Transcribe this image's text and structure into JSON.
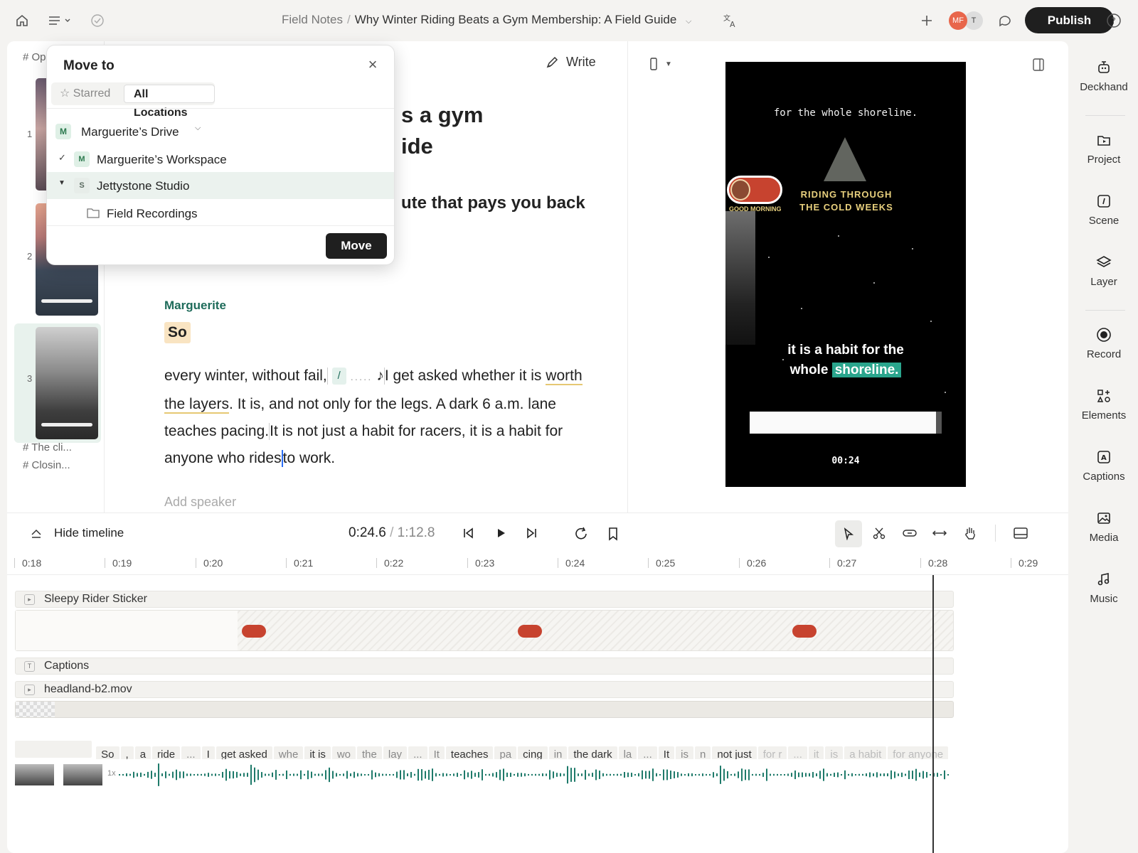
{
  "topbar": {
    "breadcrumb_parent": "Field Notes",
    "breadcrumb_sep": "/",
    "doc_title": "Why Winter Riding Beats a Gym Membership: A Field Guide",
    "avatar_1": "MF",
    "avatar_2": "T",
    "publish_label": "Publish"
  },
  "editor": {
    "scenes": [
      {
        "number": "1"
      },
      {
        "number": "2"
      },
      {
        "number": "3"
      }
    ],
    "scene_top_link": "# Op",
    "scene_links": [
      "# The cli...",
      "# Closin..."
    ],
    "write_label": "Write",
    "title_fragment_1": "s a gym",
    "title_fragment_2": "ide",
    "subtitle_fragment": "ute that pays you back",
    "speaker": "Marguerite",
    "first_word": "So",
    "paragraph": {
      "part1": "every winter, without fail,",
      "slash": "/",
      "dots": ".....",
      "note": "♪",
      "part2": "I get asked whether it is",
      "underlined": "worth the layers",
      "part3": ". It is, and not only for the legs. A dark 6 a.m. lane teaches pacing.",
      "part4": "It is not just a habit for racers, it is a habit for anyone who rides",
      "part5": "to work."
    },
    "add_speaker": "Add speaker"
  },
  "preview": {
    "top_caption": "for the whole shoreline.",
    "riding_text_1": "RIDING THROUGH",
    "riding_text_2": "THE COLD WEEKS",
    "sticker_text": "GOOD MORNING",
    "caption_line_1": "it is a habit for the",
    "caption_word": "whole",
    "caption_highlight": "shoreline.",
    "timestamp": "00:24"
  },
  "rail": {
    "items": [
      {
        "label": "Deckhand",
        "icon": "robot-icon"
      },
      {
        "label": "Project",
        "icon": "folder-play-icon"
      },
      {
        "label": "Scene",
        "icon": "scene-icon"
      },
      {
        "label": "Layer",
        "icon": "layers-icon"
      },
      {
        "label": "Record",
        "icon": "record-icon"
      },
      {
        "label": "Elements",
        "icon": "elements-icon"
      },
      {
        "label": "Captions",
        "icon": "captions-icon"
      },
      {
        "label": "Media",
        "icon": "media-icon"
      },
      {
        "label": "Music",
        "icon": "music-icon"
      }
    ]
  },
  "timeline": {
    "hide_label": "Hide timeline",
    "current_time": "0:24.6",
    "time_sep": "/",
    "total_time": "1:12.8",
    "ticks": [
      "0:18",
      "0:19",
      "0:20",
      "0:21",
      "0:22",
      "0:23",
      "0:24",
      "0:25",
      "0:26",
      "0:27",
      "0:28",
      "0:29"
    ],
    "tracks": {
      "sticker": "Sleepy Rider Sticker",
      "captions": "Captions",
      "video": "headland-b2.mov"
    },
    "speed": "1x",
    "words": [
      "So",
      ",",
      "a",
      "ride",
      "...",
      "I",
      "get asked",
      "whe",
      "it is",
      "wo",
      "the",
      "lay",
      "...",
      "It",
      "teaches",
      "pa",
      "cing",
      "in",
      "the dark",
      "la",
      "...",
      "It",
      "is",
      "n",
      "not just",
      "for r",
      "...",
      "it",
      "is",
      "a habit",
      "for anyone"
    ]
  },
  "dialog": {
    "title": "Move to",
    "tab_starred": "Starred",
    "tab_all": "All Locations",
    "drive": "Marguerite’s Drive",
    "drive_badge": "M",
    "workspace": "Marguerite’s Workspace",
    "workspace_badge": "M",
    "studio": "Jettystone Studio",
    "studio_badge": "S",
    "folder": "Field Recordings",
    "move_label": "Move"
  },
  "colors": {
    "accent": "#1e6b5a",
    "highlight": "#2aa58d",
    "sticker": "#c7432f",
    "publish": "#1f1f1f"
  }
}
